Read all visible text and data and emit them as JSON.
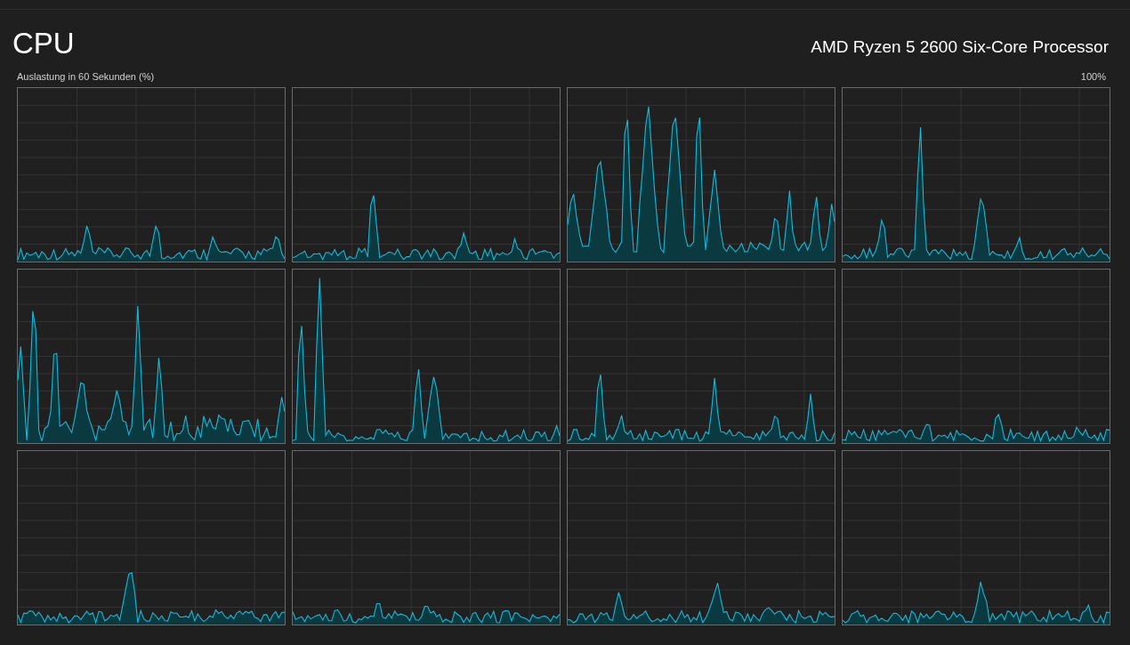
{
  "title": "CPU",
  "processor": "AMD Ryzen 5 2600 Six-Core Processor",
  "graph_caption": "Auslastung in 60 Sekunden (%)",
  "max_label": "100%"
}
